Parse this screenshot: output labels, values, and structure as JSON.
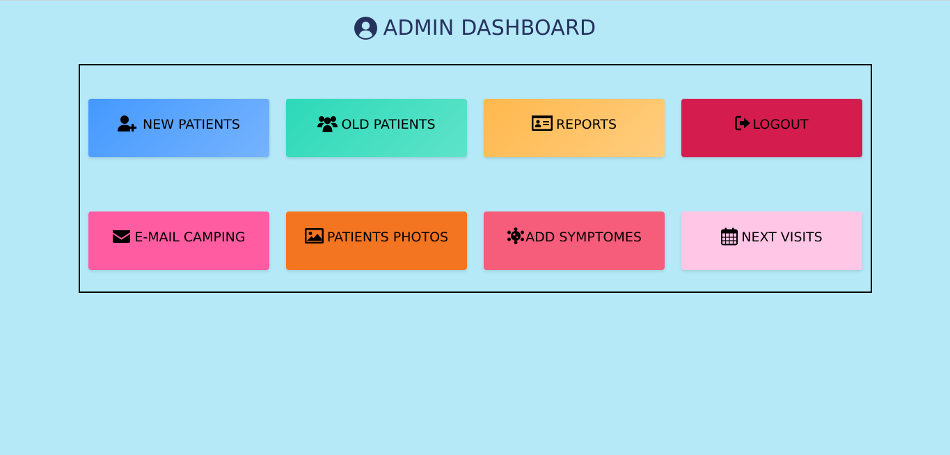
{
  "header": {
    "title": "ADMIN DASHBOARD",
    "icon": "user-circle-icon"
  },
  "tiles": [
    {
      "label": "NEW PATIENTS",
      "icon": "user-plus-icon",
      "color": "#4499fe"
    },
    {
      "label": "OLD PATIENTS",
      "icon": "users-icon",
      "color": "#2cd9b8"
    },
    {
      "label": "REPORTS",
      "icon": "id-card-icon",
      "color": "#ffb84d"
    },
    {
      "label": "LOGOUT",
      "icon": "sign-out-icon",
      "color": "#d51c4e"
    },
    {
      "label": "E-MAIL CAMPING",
      "icon": "envelope-icon",
      "color": "#ff5ca1"
    },
    {
      "label": "PATIENTS PHOTOS",
      "icon": "image-icon",
      "color": "#f37421"
    },
    {
      "label": "ADD SYMPTOMES",
      "icon": "virus-icon",
      "color": "#f55d7b"
    },
    {
      "label": "NEXT VISITS",
      "icon": "calendar-icon",
      "color": "#ffc6e6"
    }
  ]
}
